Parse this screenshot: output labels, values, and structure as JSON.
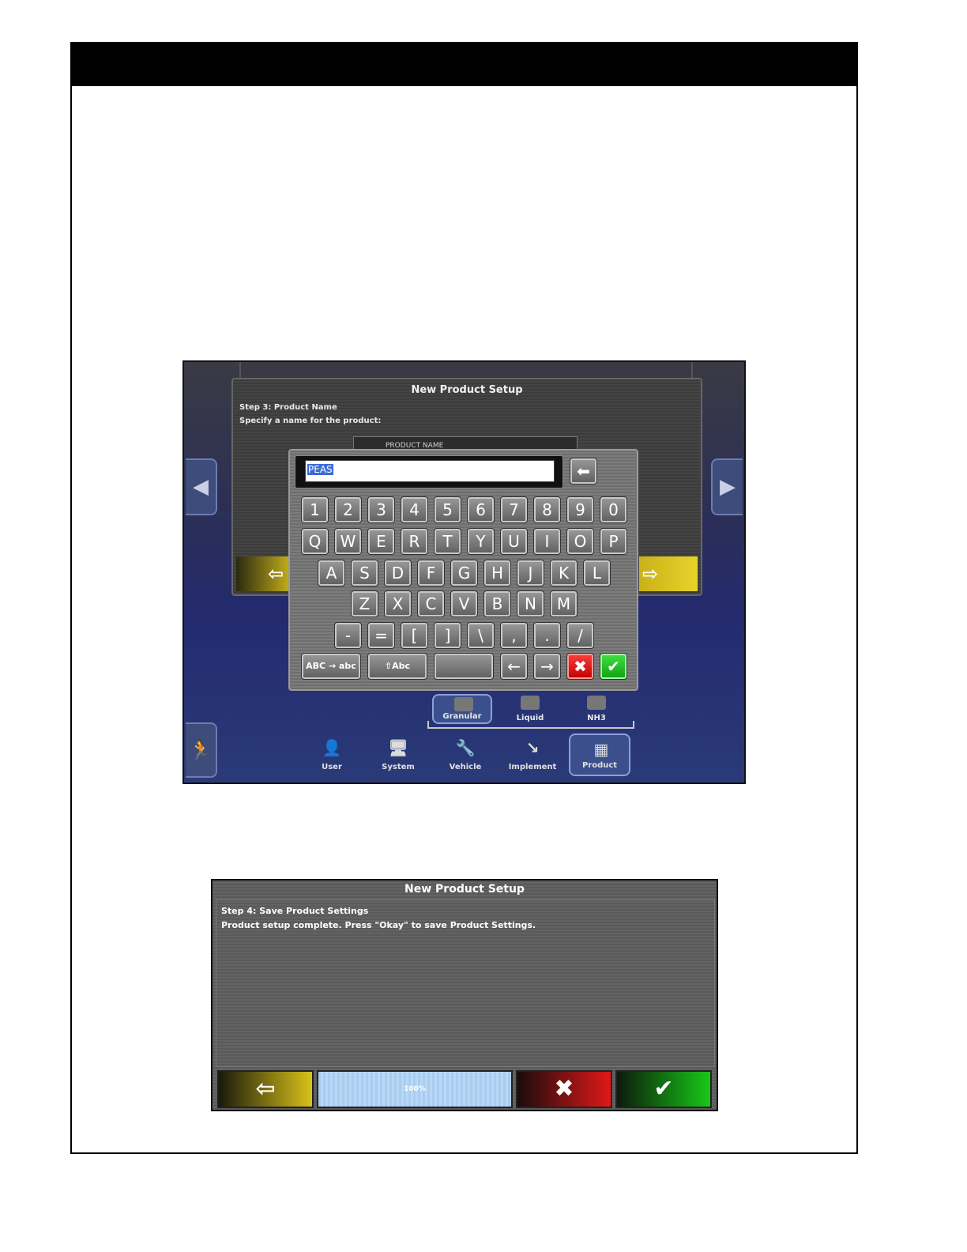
{
  "screen1": {
    "title": "New Product Setup",
    "step": "Step 3: Product Name",
    "instruction": "Specify a name for the product:",
    "field_label": "PRODUCT NAME",
    "input_value": "PEAS",
    "keys_row1": [
      "1",
      "2",
      "3",
      "4",
      "5",
      "6",
      "7",
      "8",
      "9",
      "0"
    ],
    "keys_row2": [
      "Q",
      "W",
      "E",
      "R",
      "T",
      "Y",
      "U",
      "I",
      "O",
      "P"
    ],
    "keys_row3": [
      "A",
      "S",
      "D",
      "F",
      "G",
      "H",
      "J",
      "K",
      "L"
    ],
    "keys_row4": [
      "Z",
      "X",
      "C",
      "V",
      "B",
      "N",
      "M"
    ],
    "keys_row5": [
      "-",
      "=",
      "[",
      "]",
      "\\",
      ",",
      ".",
      "/"
    ],
    "case_toggle": "ABC → abc",
    "shift_key": "⇧Abc",
    "left_key": "←",
    "right_key": "→",
    "product_tabs": [
      "Granular",
      "Liquid",
      "NH3"
    ],
    "nav_items": [
      {
        "label": "User",
        "icon": "user-icon"
      },
      {
        "label": "System",
        "icon": "system-icon"
      },
      {
        "label": "Vehicle",
        "icon": "vehicle-icon"
      },
      {
        "label": "Implement",
        "icon": "implement-icon"
      },
      {
        "label": "Product",
        "icon": "product-icon"
      }
    ]
  },
  "screen2": {
    "title": "New Product Setup",
    "step": "Step 4: Save Product Settings",
    "message": "Product setup complete. Press \"Okay\" to save Product Settings.",
    "progress_label": "100%"
  }
}
